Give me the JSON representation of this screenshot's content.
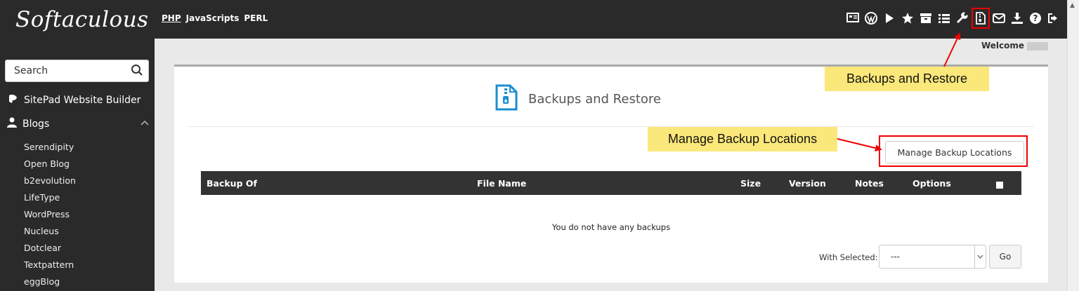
{
  "brand": {
    "logo": "Softaculous"
  },
  "topnav": {
    "php": "PHP",
    "js": "JavaScripts",
    "perl": "PERL"
  },
  "toolbar_icons": [
    "install-icon",
    "wordpress-icon",
    "play-icon",
    "star-icon",
    "archive-icon",
    "list-icon",
    "wrench-icon",
    "backup-icon",
    "mail-icon",
    "download-icon",
    "help-icon",
    "logout-icon"
  ],
  "header": {
    "welcome": "Welcome"
  },
  "sidebar": {
    "search_placeholder": "Search",
    "sitepad": "SitePad Website Builder",
    "blogs": "Blogs",
    "items": [
      "Serendipity",
      "Open Blog",
      "b2evolution",
      "LifeType",
      "WordPress",
      "Nucleus",
      "Dotclear",
      "Textpattern",
      "eggBlog"
    ]
  },
  "main": {
    "title": "Backups and Restore",
    "manage_button": "Manage Backup Locations",
    "columns": [
      "Backup Of",
      "File Name",
      "Size",
      "Version",
      "Notes",
      "Options"
    ],
    "empty_message": "You do not have any backups",
    "with_selected_label": "With Selected:",
    "select_value": "---",
    "go_button": "Go"
  },
  "callouts": {
    "backups": "Backups and Restore",
    "manage": "Manage Backup Locations"
  },
  "colors": {
    "topbar": "#2a2a2a",
    "accent_blue": "#1a8fd1",
    "callout": "#fbe87a",
    "highlight_red": "#e00000"
  }
}
